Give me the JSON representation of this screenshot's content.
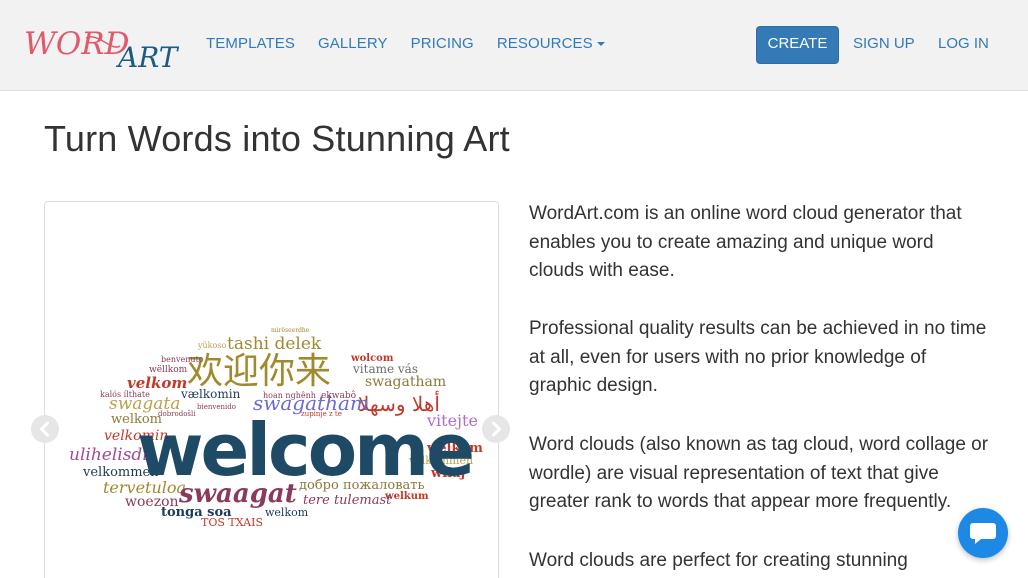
{
  "brand": {
    "logo_text_word": "WORD",
    "logo_text_art": "ART",
    "colors": {
      "accent": "#337ab7",
      "chat": "#1e88e5"
    }
  },
  "nav": {
    "templates": "TEMPLATES",
    "gallery": "GALLERY",
    "pricing": "PRICING",
    "resources": "RESOURCES",
    "create": "CREATE",
    "signup": "SIGN UP",
    "login": "LOG IN"
  },
  "main": {
    "title": "Turn Words into Stunning Art",
    "paragraphs": [
      "WordArt.com is an online word cloud generator that enables you to create amazing and unique word clouds with ease.",
      "Professional quality results can be achieved in no time at all, even for users with no prior knowledge of graphic design.",
      "Word clouds (also known as tag cloud, word collage or wordle) are visual representation of text that give greater rank to words that appear more frequently.",
      "Word clouds are perfect for creating stunning"
    ]
  },
  "cloud": {
    "main_word": "welcome",
    "words": [
      "yükoso",
      "tashi delek",
      "欢迎你来",
      "wolcom",
      "vitame vás",
      "swagatham",
      "أهلا وسهلا",
      "velkom",
      "swagata",
      "vælkomin",
      "swagatham",
      "welkom",
      "velkomin",
      "vitejte",
      "welkom",
      "ulihelisdi",
      "välkommen",
      "wilaj",
      "velkommen",
      "tervetuloa",
      "swaagat",
      "добро пожаловать",
      "woezon",
      "welkum",
      "tere tulemast",
      "tonga soa",
      "welkom",
      "TOS TXAIS",
      "mirëseerdhe",
      "wëllkom",
      "benvenuto",
      "hoan nghênh",
      "ekwabô",
      "dobrodošli",
      "kalós ílthate",
      "bienvenido",
      "zupinje z te"
    ]
  }
}
